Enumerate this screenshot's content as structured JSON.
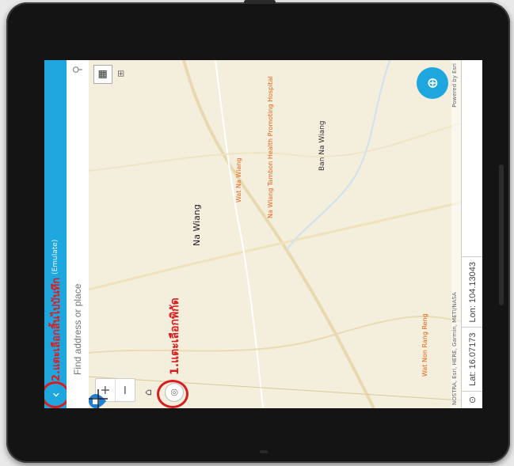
{
  "header": {
    "title": "2.แตะเลือกสิ้นไปบันทึก",
    "subtitle": "(Emulate)"
  },
  "search": {
    "placeholder": "Find address or place"
  },
  "annotations": {
    "step1": "1.แตะเลือกพิกัด"
  },
  "map": {
    "main_place": "Na Wiang",
    "places": [
      "Ban Na Wiang",
      "Wat Na Wiang",
      "Na Wiang Tambon Health Promoting Hospital",
      "Wat Non Rang Reng"
    ],
    "attribution_left": "NOSTRA, Esri, HERE, Garmin, METI/NASA",
    "attribution_right": "Powered by Esri"
  },
  "coords": {
    "lat_label": "Lat:",
    "lat_value": "16.07173",
    "lon_label": "Lon:",
    "lon_value": "104.13043"
  },
  "icons": {
    "back": "back-arrow-icon",
    "search": "search-icon",
    "qr": "qr-code-icon",
    "locate": "locate-icon",
    "pin": "map-pin-icon",
    "fab": "add-location-icon"
  },
  "colors": {
    "accent": "#1ea7df",
    "annotation": "#d81d20",
    "map_bg": "#f4efdc",
    "road_red": "#e1641c"
  }
}
